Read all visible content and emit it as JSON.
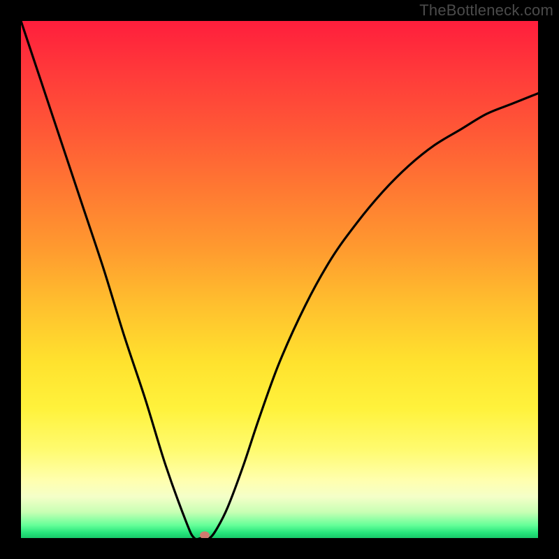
{
  "watermark": "TheBottleneck.com",
  "chart_data": {
    "type": "line",
    "title": "",
    "xlabel": "",
    "ylabel": "",
    "xlim": [
      0,
      1
    ],
    "ylim": [
      0,
      1
    ],
    "grid": false,
    "legend": false,
    "series": [
      {
        "name": "curve",
        "x": [
          0.0,
          0.04,
          0.08,
          0.12,
          0.16,
          0.2,
          0.24,
          0.28,
          0.32,
          0.335,
          0.35,
          0.365,
          0.38,
          0.4,
          0.43,
          0.46,
          0.5,
          0.55,
          0.6,
          0.65,
          0.7,
          0.75,
          0.8,
          0.85,
          0.9,
          0.95,
          1.0
        ],
        "y": [
          1.0,
          0.88,
          0.76,
          0.64,
          0.52,
          0.39,
          0.27,
          0.14,
          0.03,
          0.0,
          0.0,
          0.0,
          0.02,
          0.06,
          0.14,
          0.23,
          0.34,
          0.45,
          0.54,
          0.61,
          0.67,
          0.72,
          0.76,
          0.79,
          0.82,
          0.84,
          0.86
        ]
      }
    ],
    "marker": {
      "x": 0.355,
      "y": 0.0
    },
    "colors": {
      "curve": "#000000",
      "marker": "#cf7a6f",
      "gradient_top": "#ff1e3c",
      "gradient_mid": "#ffe22e",
      "gradient_bottom": "#19c96a",
      "frame": "#000000"
    }
  }
}
